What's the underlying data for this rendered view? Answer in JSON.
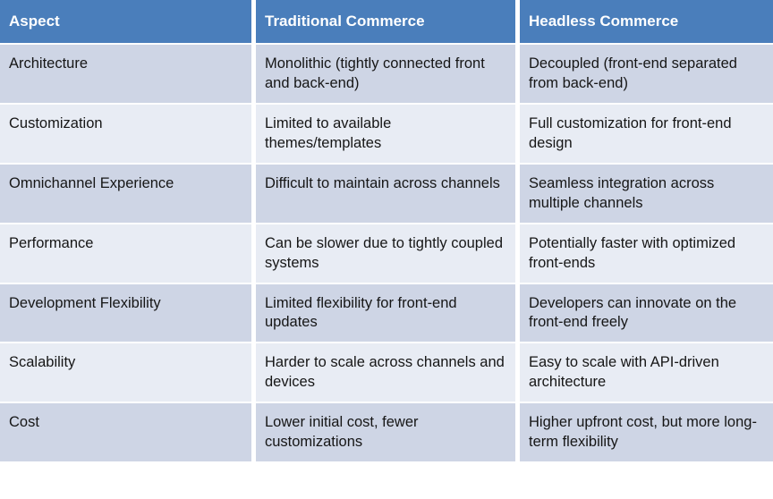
{
  "table": {
    "headers": [
      {
        "label": "Aspect"
      },
      {
        "label": "Traditional Commerce"
      },
      {
        "label": "Headless Commerce"
      }
    ],
    "rows": [
      {
        "aspect": "Architecture",
        "traditional": "Monolithic (tightly connected front and back-end)",
        "headless": "Decoupled (front-end separated from back-end)"
      },
      {
        "aspect": "Customization",
        "traditional": "Limited to available themes/templates",
        "headless": "Full customization for front-end design"
      },
      {
        "aspect": "Omnichannel Experience",
        "traditional": "Difficult to maintain across channels",
        "headless": "Seamless integration across multiple channels"
      },
      {
        "aspect": "Performance",
        "traditional": "Can be slower due to tightly coupled systems",
        "headless": "Potentially faster with optimized front-ends"
      },
      {
        "aspect": "Development Flexibility",
        "traditional": "Limited flexibility for front-end updates",
        "headless": "Developers can innovate on the front-end freely"
      },
      {
        "aspect": "Scalability",
        "traditional": "Harder to scale across channels and devices",
        "headless": "Easy to scale with API-driven architecture"
      },
      {
        "aspect": "Cost",
        "traditional": "Lower initial cost, fewer customizations",
        "headless": "Higher upfront cost, but more long-term flexibility"
      }
    ],
    "colors": {
      "header_background": "#4A7EBB",
      "header_text": "#FFFFFF",
      "row_band_dark": "#CED5E5",
      "row_band_light": "#E8ECF4",
      "body_text": "#161616",
      "grid_line": "#FFFFFF"
    }
  }
}
